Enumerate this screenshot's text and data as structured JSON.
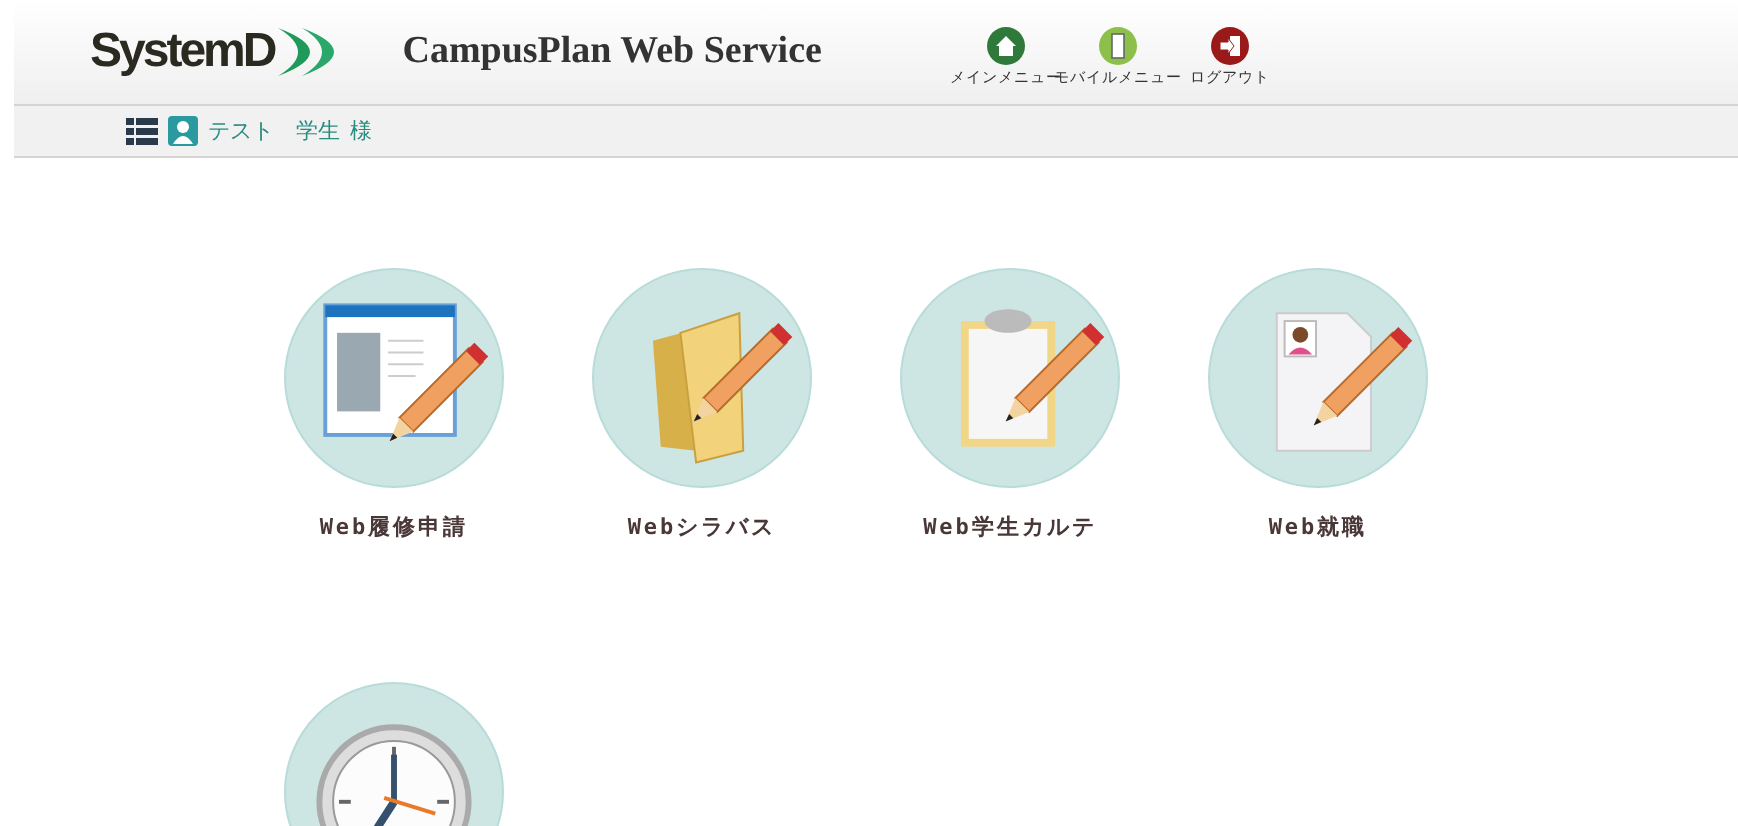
{
  "header": {
    "logo": "SystemD",
    "title": "CampusPlan Web Service",
    "nav": [
      {
        "kind": "home",
        "label": "メインメニュー"
      },
      {
        "kind": "mobile",
        "label": "モバイルメニュー"
      },
      {
        "kind": "logout",
        "label": "ログアウト"
      }
    ]
  },
  "user_bar": {
    "name": "テスト　学生",
    "honorific": "様"
  },
  "tiles": [
    {
      "kind": "window",
      "label": "Web履修申請"
    },
    {
      "kind": "folder",
      "label": "Webシラバス"
    },
    {
      "kind": "clipboard",
      "label": "Web学生カルテ"
    },
    {
      "kind": "resume",
      "label": "Web就職"
    },
    {
      "kind": "clock"
    }
  ]
}
